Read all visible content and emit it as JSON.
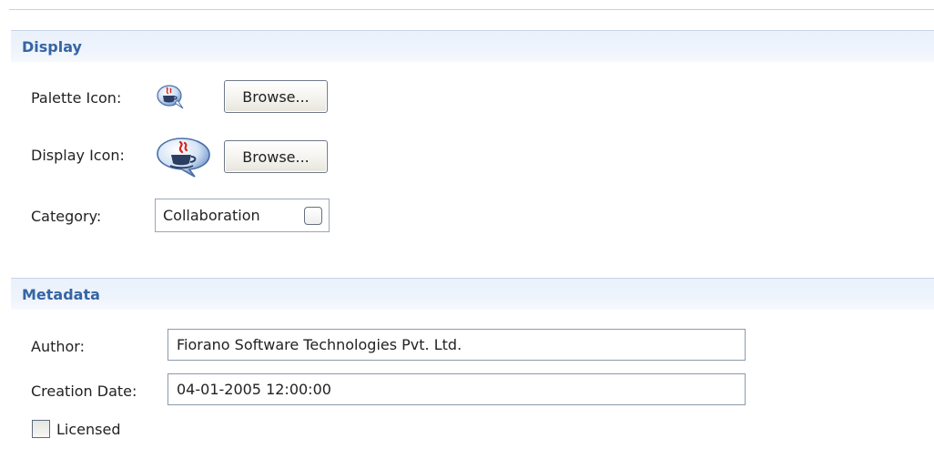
{
  "display": {
    "title": "Display",
    "palette_icon_label": "Palette Icon:",
    "display_icon_label": "Display Icon:",
    "category_label": "Category:",
    "browse_label": "Browse...",
    "category_value": "Collaboration",
    "palette_icon": "java-coffee-cup-icon",
    "display_icon": "java-coffee-cup-icon"
  },
  "metadata": {
    "title": "Metadata",
    "author_label": "Author:",
    "author_value": "Fiorano Software Technologies Pvt. Ltd.",
    "creation_date_label": "Creation Date:",
    "creation_date_value": "04-01-2005 12:00:00",
    "licensed_label": "Licensed",
    "licensed_checked": false
  },
  "colors": {
    "section_title": "#3565a5",
    "section_background": "#eef4fc",
    "java_icon_accent": "#d8231b"
  }
}
